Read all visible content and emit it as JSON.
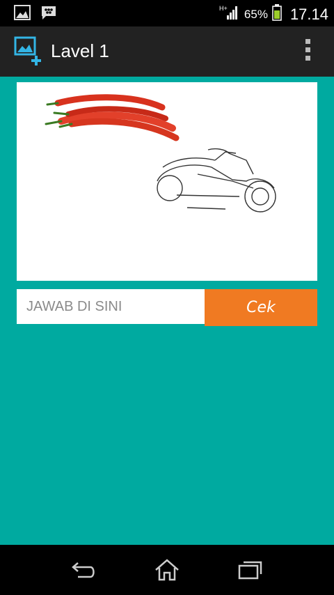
{
  "status": {
    "network": "H+",
    "battery": "65%",
    "time": "17.14"
  },
  "app": {
    "title": "Lavel 1"
  },
  "quiz": {
    "answer_placeholder": "JAWAB DI SINI",
    "check_label": "Cek"
  },
  "colors": {
    "background": "#00aaa0",
    "button": "#f07a22",
    "action_bar": "#222222"
  },
  "icons": {
    "status_left": [
      "gallery-icon",
      "bbm-icon"
    ],
    "status_right": [
      "signal-icon",
      "battery-icon"
    ],
    "action_bar": [
      "add-image-icon",
      "overflow-menu-icon"
    ],
    "nav": [
      "back-icon",
      "home-icon",
      "recent-apps-icon"
    ]
  }
}
